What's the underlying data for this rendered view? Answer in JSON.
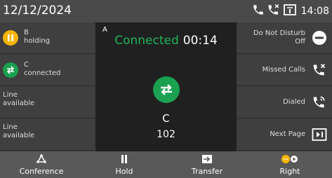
{
  "status_bar": {
    "date": "12/12/2024",
    "time": "14:08"
  },
  "line_keys": [
    {
      "title": "B",
      "subtitle": "holding"
    },
    {
      "title": "C",
      "subtitle": "connected"
    },
    {
      "title": "Line",
      "subtitle": "available"
    },
    {
      "title": "Line",
      "subtitle": "available"
    }
  ],
  "right_keys": {
    "dnd_line1": "Do Not Disturb",
    "dnd_line2": "Off",
    "missed_calls": "Missed Calls",
    "dialed": "Dialed",
    "next_page": "Next Page"
  },
  "call": {
    "line_letter": "A",
    "status": "Connected",
    "timer": "00:14",
    "party_name": "C",
    "party_number": "102"
  },
  "softkeys": [
    "Conference",
    "Hold",
    "Transfer",
    "Right"
  ],
  "colors": {
    "connected": "#1db35b",
    "hold": "#f4b400",
    "transfer": "#1aa14f"
  },
  "icons": [
    "phone-icon",
    "missed-call-icon",
    "voicemail-icon",
    "pause-icon",
    "transfer-icon",
    "minus-circle-icon",
    "dialed-call-icon",
    "next-page-icon",
    "conference-icon",
    "hold-icon",
    "transfer-arrow-icon",
    "more-icon"
  ]
}
